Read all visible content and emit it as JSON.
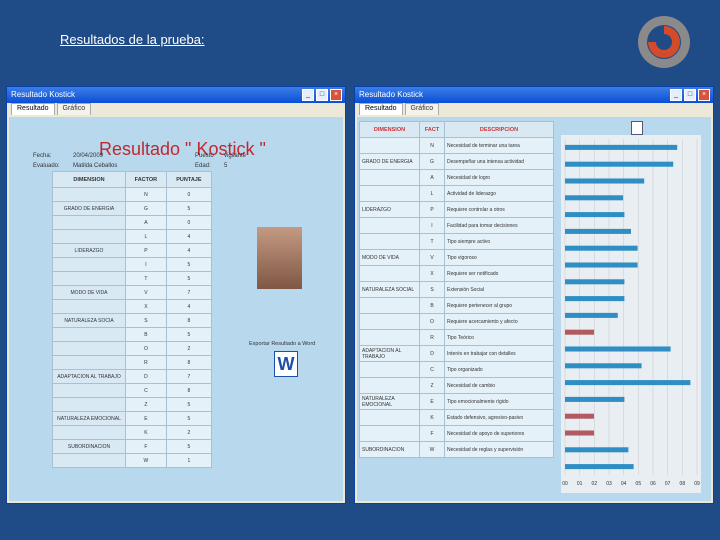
{
  "slide": {
    "title": "Resultados de la prueba:"
  },
  "window_left": {
    "title": "Resultado Kostick",
    "tabs": [
      "Resultado",
      "Gráfico"
    ],
    "heading": "Resultado \" Kostick \"",
    "labels": {
      "fecha": "Fecha:",
      "evaluado": "Evaluado:",
      "puesto": "Puesto",
      "edad": "Edad:"
    },
    "values": {
      "fecha": "20/04/2009",
      "evaluado": "Matilda Ceballos",
      "puesto": "vigilante",
      "edad": "5"
    },
    "table_headers": [
      "DIMENSION",
      "FACTOR",
      "PUNTAJE"
    ],
    "rows": [
      [
        "",
        "N",
        "0"
      ],
      [
        "GRADO DE ENERGIA",
        "G",
        "5"
      ],
      [
        "",
        "A",
        "0"
      ],
      [
        "",
        "L",
        "4"
      ],
      [
        "LIDERAZGO",
        "P",
        "4"
      ],
      [
        "",
        "I",
        "5"
      ],
      [
        "",
        "T",
        "5"
      ],
      [
        "MODO DE VIDA",
        "V",
        "7"
      ],
      [
        "",
        "X",
        "4"
      ],
      [
        "NATURALEZA SOCIA",
        "S",
        "8"
      ],
      [
        "",
        "B",
        "5"
      ],
      [
        "",
        "O",
        "2"
      ],
      [
        "",
        "R",
        "8"
      ],
      [
        "ADAPTACION AL TRABAJO",
        "D",
        "7"
      ],
      [
        "",
        "C",
        "8"
      ],
      [
        "",
        "Z",
        "5"
      ],
      [
        "NATURALEZA EMOCIONAL",
        "E",
        "5"
      ],
      [
        "",
        "K",
        "2"
      ],
      [
        "SUBORDINACION",
        "F",
        "5"
      ],
      [
        "",
        "W",
        "1"
      ]
    ],
    "export_label": "Exportar Resultado a Word"
  },
  "window_right": {
    "title": "Resultado Kostick",
    "tabs": [
      "Resultado",
      "Gráfico"
    ],
    "headers": [
      "DIMENSION",
      "FACT",
      "DESCRIPCION"
    ],
    "rows": [
      [
        "",
        "N",
        "Necesidad de terminar una tarea"
      ],
      [
        "GRADO DE ENERGIA",
        "G",
        "Desempeñar una intensa actividad"
      ],
      [
        "",
        "A",
        "Necesidad de logro"
      ],
      [
        "",
        "L",
        "Actividad de liderazgo"
      ],
      [
        "LIDERAZGO",
        "P",
        "Requiere controlar a otros"
      ],
      [
        "",
        "I",
        "Facilidad para tomar decisiones"
      ],
      [
        "",
        "T",
        "Tipo siempre activo"
      ],
      [
        "MODO DE VIDA",
        "V",
        "Tipo vigoroso"
      ],
      [
        "",
        "X",
        "Requiere ser notificado"
      ],
      [
        "NATURALEZA SOCIAL",
        "S",
        "Extensión Social"
      ],
      [
        "",
        "B",
        "Requiere pertenecer al grupo"
      ],
      [
        "",
        "O",
        "Requiere acercamiento y afecto"
      ],
      [
        "",
        "R",
        "Tipo Teórico"
      ],
      [
        "ADAPTACION AL TRABAJO",
        "D",
        "Interés en trabajar con detalles"
      ],
      [
        "",
        "C",
        "Tipo organizado"
      ],
      [
        "",
        "Z",
        "Necesidad de cambio"
      ],
      [
        "NATURALEZA EMOCIONAL",
        "E",
        "Tipo emocionalmente rígido"
      ],
      [
        "",
        "K",
        "Estado defensivo, agresivo-pasivo"
      ],
      [
        "",
        "F",
        "Necesidad de apoyo de superiores"
      ],
      [
        "SUBORDINACION",
        "W",
        "Necesidad de reglas y supervisión"
      ]
    ],
    "chart_data": {
      "type": "bar",
      "orientation": "horizontal",
      "categories": [
        "N",
        "G",
        "A",
        "L",
        "P",
        "I",
        "T",
        "V",
        "X",
        "S",
        "B",
        "O",
        "R",
        "D",
        "C",
        "Z",
        "E",
        "K",
        "F",
        "W"
      ],
      "values": [
        0.85,
        0.82,
        0.6,
        0.44,
        0.45,
        0.5,
        0.55,
        0.55,
        0.45,
        0.45,
        0.4,
        0.22,
        0.8,
        0.58,
        0.95,
        0.45,
        0.22,
        0.22,
        0.48,
        0.52
      ],
      "bar_colors": [
        "#2f8fc5",
        "#2f8fc5",
        "#2f8fc5",
        "#2f8fc5",
        "#2f8fc5",
        "#2f8fc5",
        "#2f8fc5",
        "#2f8fc5",
        "#2f8fc5",
        "#2f8fc5",
        "#2f8fc5",
        "#b25a62",
        "#2f8fc5",
        "#2f8fc5",
        "#2f8fc5",
        "#2f8fc5",
        "#b25a62",
        "#b25a62",
        "#2f8fc5",
        "#2f8fc5"
      ],
      "tick_labels": [
        "00",
        "01",
        "02",
        "03",
        "04",
        "05",
        "06",
        "07",
        "08",
        "09"
      ]
    }
  }
}
